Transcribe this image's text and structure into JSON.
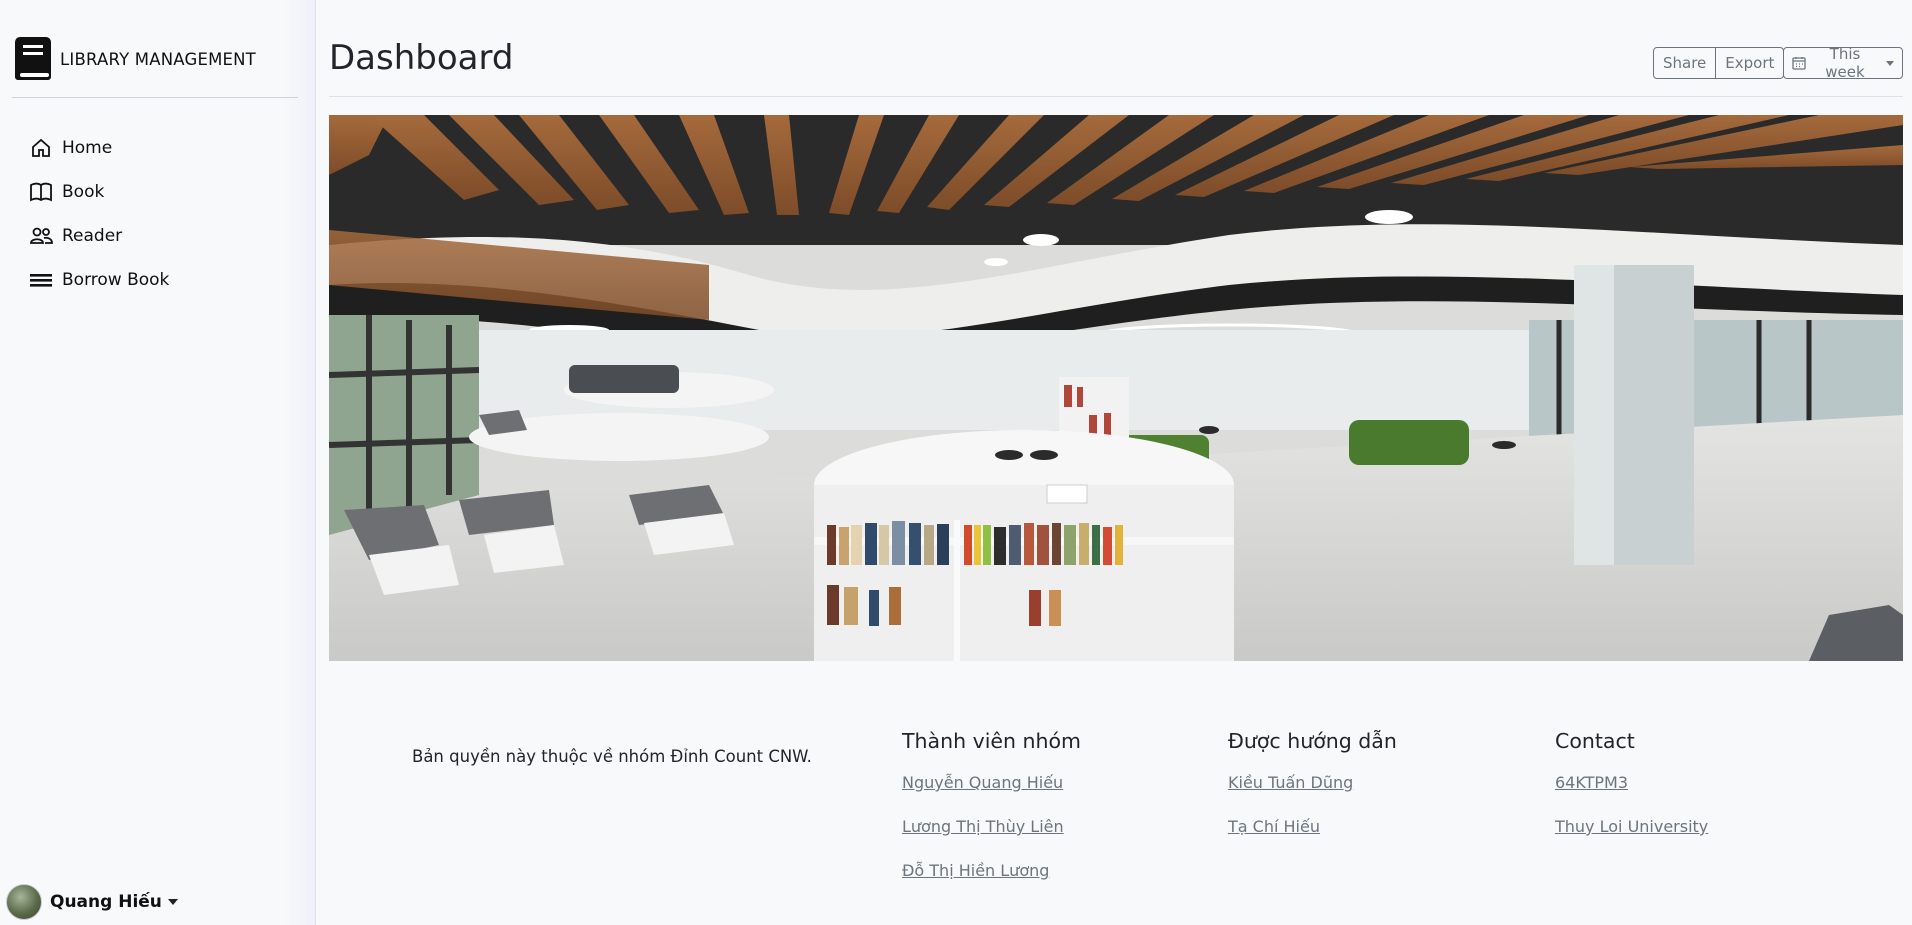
{
  "brand": {
    "title": "LIBRARY MANAGEMENT",
    "icon": "book-icon"
  },
  "sidebar": {
    "items": [
      {
        "label": "Home",
        "icon": "house-icon"
      },
      {
        "label": "Book",
        "icon": "open-book-icon"
      },
      {
        "label": "Reader",
        "icon": "people-icon"
      },
      {
        "label": "Borrow Book",
        "icon": "list-icon"
      }
    ]
  },
  "user": {
    "name": "Quang Hiếu"
  },
  "header": {
    "title": "Dashboard",
    "share_label": "Share",
    "export_label": "Export",
    "period_label": "This week"
  },
  "footer": {
    "copyright": "Bản quyền này thuộc về nhóm Đỉnh Count CNW.",
    "columns": [
      {
        "title": "Thành viên nhóm",
        "links": [
          "Nguyễn Quang Hiếu",
          "Lương Thị Thùy Liên",
          "Đỗ Thị Hiền Lương"
        ]
      },
      {
        "title": "Được hướng dẫn",
        "links": [
          "Kiều Tuấn Dũng",
          "Tạ Chí Hiếu"
        ]
      },
      {
        "title": "Contact",
        "links": [
          "64KTPM3",
          "Thuy Loi University"
        ]
      }
    ]
  },
  "colors": {
    "text": "#212529",
    "muted": "#6c757d",
    "background": "#f8f9fa"
  }
}
